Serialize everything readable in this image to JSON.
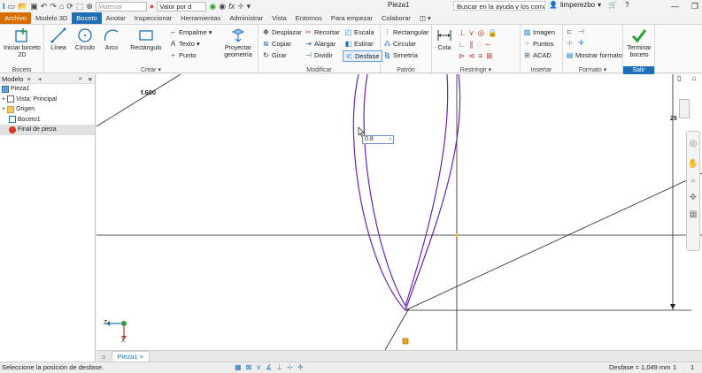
{
  "titlebar": {
    "material_placeholder": "Material",
    "appearance_value": "Valor por d",
    "doc_title": "Pieza1",
    "help_search_placeholder": "Buscar en la ayuda y los comandos",
    "user": "limperezbo"
  },
  "tabs": [
    "Archivo",
    "Modelo 3D",
    "Boceto",
    "Anotar",
    "Inspeccionar",
    "Herramientas",
    "Administrar",
    "Vista",
    "Entornos",
    "Para empezar",
    "Colaborar"
  ],
  "ribbon": {
    "boceto": {
      "title": "Boceto",
      "start_sketch": "Iniciar boceto 2D"
    },
    "crear": {
      "title": "Crear",
      "linea": "Línea",
      "circulo": "Círculo",
      "arco": "Arco",
      "rectangulo": "Rectángulo",
      "empalme": "Empalme",
      "texto": "Texto",
      "punto": "Punto",
      "proyectar": "Proyectar geometría"
    },
    "modificar": {
      "title": "Modificar",
      "desplazar": "Desplazar",
      "recortar": "Recortar",
      "escala": "Escala",
      "copiar": "Copiar",
      "alargar": "Alargar",
      "estirar": "Estirar",
      "girar": "Girar",
      "dividir": "Dividir",
      "desfase": "Desfase"
    },
    "patron": {
      "title": "Patrón",
      "rectangular": "Rectangular",
      "circular": "Circular",
      "simetria": "Simetría"
    },
    "restringir": {
      "title": "Restringir",
      "cota": "Cota"
    },
    "insertar": {
      "title": "Insertar",
      "imagen": "Imagen",
      "puntos": "Puntos",
      "acad": "ACAD"
    },
    "formato": {
      "title": "Formato",
      "mostrar": "Mostrar formato"
    },
    "salir": {
      "title": "Salir",
      "terminar": "Terminar boceto"
    }
  },
  "browser": {
    "tab_label": "Modelo",
    "items": [
      {
        "label": "Pieza1"
      },
      {
        "label": "Vista: Principal"
      },
      {
        "label": "Origen"
      },
      {
        "label": "Boceto1"
      },
      {
        "label": "Final de pieza"
      }
    ]
  },
  "canvas": {
    "dimension_label": "f.600",
    "offset_input": "0.8",
    "right_dim": "25",
    "axis_z": "Z",
    "axis_x": "X"
  },
  "doc_tabs": {
    "active": "Pieza1"
  },
  "status": {
    "message": "Seleccione la posición de desfase.",
    "measure": "Desfase = 1,049 mm",
    "count1": "1",
    "count2": "1"
  },
  "colors": {
    "accent": "#1f6fb6",
    "file_tab": "#d96c00",
    "curve": "#6a22b8"
  }
}
